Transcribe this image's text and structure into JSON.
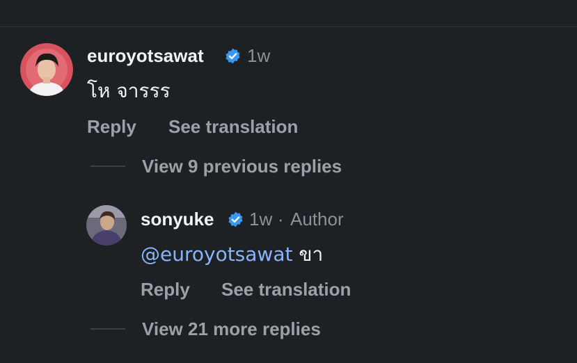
{
  "comment": {
    "username": "euroyotsawat",
    "verified_icon": "verified-badge-icon",
    "time": "1w",
    "text": "โห จารรร",
    "reply_label": "Reply",
    "translate_label": "See translation",
    "view_previous_label": "View 9 previous replies"
  },
  "reply": {
    "username": "sonyuke",
    "verified_icon": "verified-badge-icon",
    "time": "1w",
    "separator": "·",
    "author_badge": "Author",
    "mention": "@euroyotsawat",
    "text": "ขา",
    "reply_label": "Reply",
    "translate_label": "See translation",
    "view_more_label": "View 21 more replies"
  },
  "colors": {
    "background": "#1e2124",
    "verified": "#3897f0",
    "mention": "#8ab4f8",
    "muted": "#9aa1a8"
  }
}
